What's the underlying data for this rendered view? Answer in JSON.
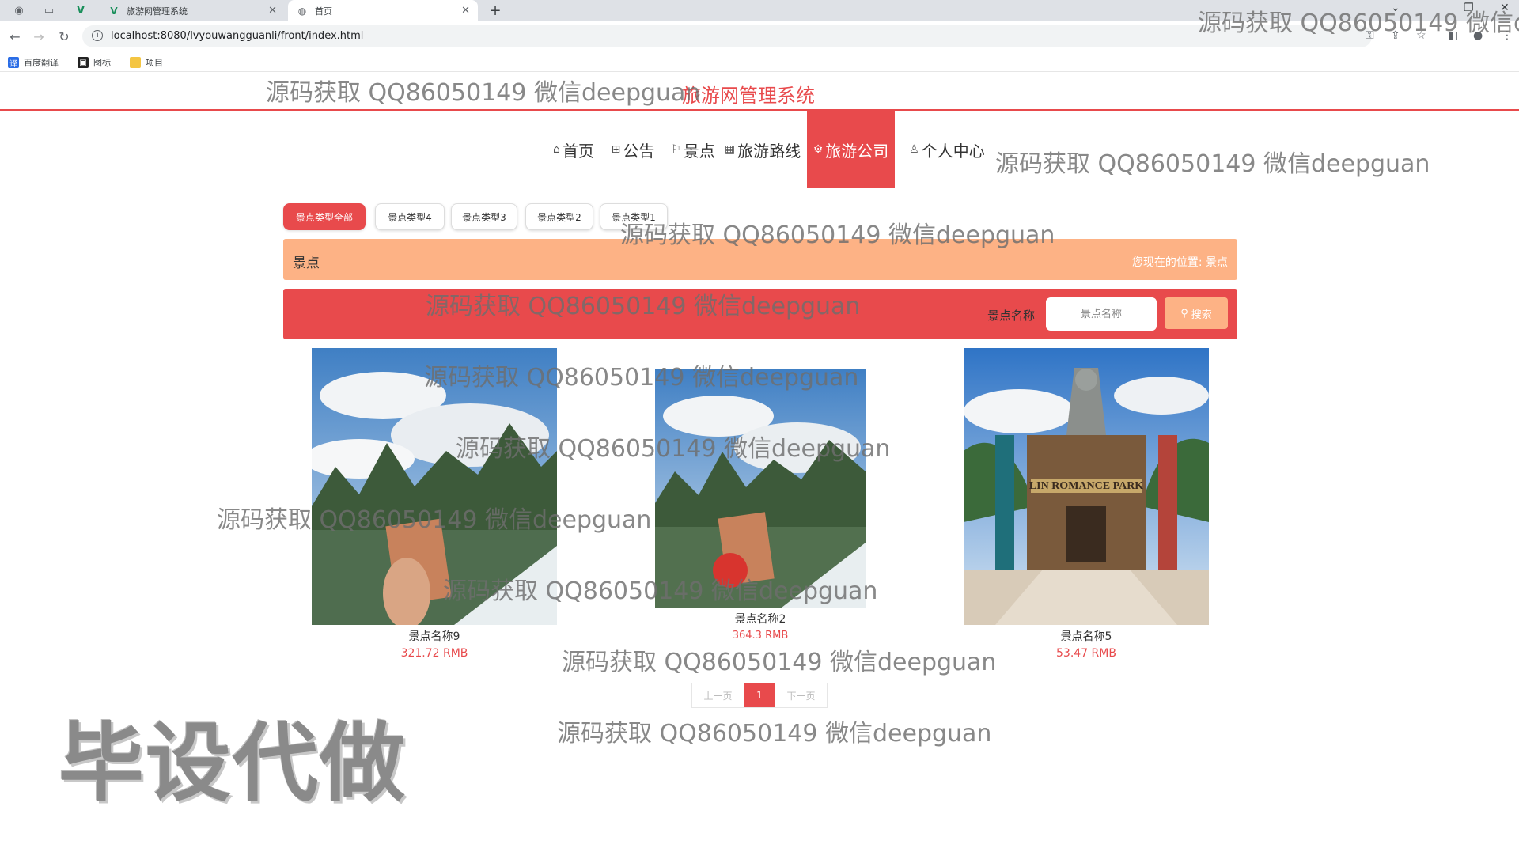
{
  "browser": {
    "tabs": [
      {
        "title": "旅游网管理系统"
      },
      {
        "title": "首页"
      }
    ],
    "url": "localhost:8080/lvyouwangguanli/front/index.html",
    "bookmarks": [
      "百度翻译",
      "图标",
      "项目"
    ]
  },
  "site": {
    "title": "旅游网管理系统",
    "nav": [
      {
        "label": "首页",
        "icon": "home-icon"
      },
      {
        "label": "公告",
        "icon": "notice-icon"
      },
      {
        "label": "景点",
        "icon": "flag-icon"
      },
      {
        "label": "旅游路线",
        "icon": "route-icon"
      },
      {
        "label": "旅游公司",
        "icon": "company-icon",
        "active": true
      },
      {
        "label": "个人中心",
        "icon": "user-icon"
      }
    ]
  },
  "filters": {
    "categories": [
      "景点类型全部",
      "景点类型4",
      "景点类型3",
      "景点类型2",
      "景点类型1"
    ],
    "active": "景点类型全部"
  },
  "breadcrumb": {
    "title": "景点",
    "position_label": "您现在的位置:",
    "position_value": "景点"
  },
  "search": {
    "label": "景点名称",
    "placeholder": "景点名称",
    "button": "搜索"
  },
  "items": [
    {
      "name": "景点名称9",
      "price": "321.72 RMB"
    },
    {
      "name": "景点名称2",
      "price": "364.3 RMB"
    },
    {
      "name": "景点名称5",
      "price": "53.47 RMB"
    }
  ],
  "pagination": {
    "prev": "上一页",
    "current": "1",
    "next": "下一页"
  },
  "watermarks": {
    "text": "源码获取 QQ86050149 微信deepguan",
    "top_right": "源码获取 QQ86050149 微信d",
    "stamp": "毕设代做"
  },
  "colors": {
    "accent": "#e84a4c",
    "peach": "#fdb285"
  }
}
